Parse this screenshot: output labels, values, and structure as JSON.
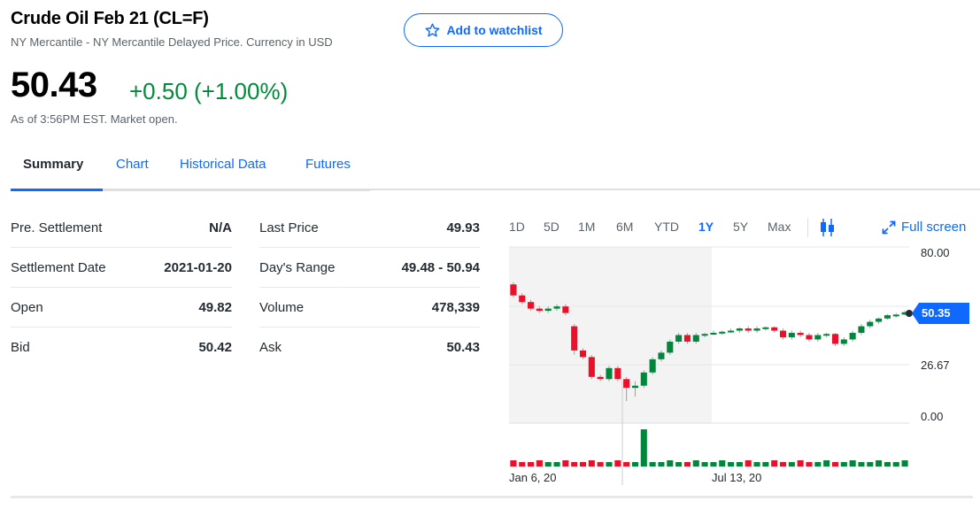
{
  "header": {
    "title": "Crude Oil Feb 21 (CL=F)",
    "subtitle": "NY Mercantile - NY Mercantile Delayed Price. Currency in USD",
    "watchlist_label": "Add to watchlist"
  },
  "quote": {
    "price": "50.43",
    "change": "+0.50 (+1.00%)",
    "as_of": "As of 3:56PM EST. Market open.",
    "change_color": "#008a3b"
  },
  "tabs": [
    {
      "label": "Summary",
      "active": true
    },
    {
      "label": "Chart",
      "active": false
    },
    {
      "label": "Historical Data",
      "active": false
    },
    {
      "label": "Futures",
      "active": false
    }
  ],
  "stats_left": [
    {
      "label": "Pre. Settlement",
      "value": "N/A"
    },
    {
      "label": "Settlement Date",
      "value": "2021-01-20"
    },
    {
      "label": "Open",
      "value": "49.82"
    },
    {
      "label": "Bid",
      "value": "50.42"
    }
  ],
  "stats_right": [
    {
      "label": "Last Price",
      "value": "49.93"
    },
    {
      "label": "Day's Range",
      "value": "49.48 - 50.94"
    },
    {
      "label": "Volume",
      "value": "478,339"
    },
    {
      "label": "Ask",
      "value": "50.43"
    }
  ],
  "chart_controls": {
    "ranges": [
      "1D",
      "5D",
      "1M",
      "6M",
      "YTD",
      "1Y",
      "5Y",
      "Max"
    ],
    "active_range": "1Y",
    "fullscreen_label": "Full screen",
    "chart_type_icon": "candlestick-icon"
  },
  "chart_data": {
    "type": "candlestick",
    "y_ticks": [
      "80.00",
      "26.67",
      "0.00"
    ],
    "x_ticks": [
      "Jan 6, 20",
      "Jul 13, 20"
    ],
    "current_price_tag": "50.35",
    "up_color": "#00873c",
    "down_color": "#eb0f29",
    "candles": [
      {
        "o": 63,
        "c": 58,
        "h": 64,
        "l": 57
      },
      {
        "o": 58,
        "c": 55,
        "h": 59,
        "l": 54
      },
      {
        "o": 55,
        "c": 52,
        "h": 56,
        "l": 51
      },
      {
        "o": 52,
        "c": 51,
        "h": 53,
        "l": 50
      },
      {
        "o": 51,
        "c": 52,
        "h": 53,
        "l": 50
      },
      {
        "o": 52,
        "c": 53,
        "h": 54,
        "l": 51
      },
      {
        "o": 53,
        "c": 50,
        "h": 54,
        "l": 49
      },
      {
        "o": 44,
        "c": 33,
        "h": 45,
        "l": 31
      },
      {
        "o": 33,
        "c": 30,
        "h": 34,
        "l": 29
      },
      {
        "o": 30,
        "c": 21,
        "h": 31,
        "l": 20
      },
      {
        "o": 21,
        "c": 20,
        "h": 22,
        "l": 19
      },
      {
        "o": 20,
        "c": 25,
        "h": 26,
        "l": 19
      },
      {
        "o": 25,
        "c": 20,
        "h": 26,
        "l": 19
      },
      {
        "o": 20,
        "c": 16,
        "h": 21,
        "l": 10
      },
      {
        "o": 16,
        "c": 17,
        "h": 19,
        "l": 12
      },
      {
        "o": 17,
        "c": 23,
        "h": 24,
        "l": 16
      },
      {
        "o": 23,
        "c": 29,
        "h": 30,
        "l": 22
      },
      {
        "o": 29,
        "c": 32,
        "h": 33,
        "l": 28
      },
      {
        "o": 32,
        "c": 37,
        "h": 38,
        "l": 31
      },
      {
        "o": 37,
        "c": 40,
        "h": 41,
        "l": 36
      },
      {
        "o": 40,
        "c": 37,
        "h": 41,
        "l": 36
      },
      {
        "o": 37,
        "c": 40,
        "h": 41,
        "l": 36
      },
      {
        "o": 40,
        "c": 40.5,
        "h": 41,
        "l": 39
      },
      {
        "o": 40.5,
        "c": 41,
        "h": 42,
        "l": 40
      },
      {
        "o": 41,
        "c": 41.5,
        "h": 42,
        "l": 40
      },
      {
        "o": 41.5,
        "c": 42,
        "h": 43,
        "l": 41
      },
      {
        "o": 42,
        "c": 43,
        "h": 43.5,
        "l": 41
      },
      {
        "o": 43,
        "c": 42,
        "h": 44,
        "l": 41
      },
      {
        "o": 42,
        "c": 43,
        "h": 44,
        "l": 41
      },
      {
        "o": 43,
        "c": 43.5,
        "h": 44,
        "l": 42
      },
      {
        "o": 43.5,
        "c": 42,
        "h": 44,
        "l": 41
      },
      {
        "o": 42,
        "c": 39,
        "h": 43,
        "l": 38
      },
      {
        "o": 39,
        "c": 41,
        "h": 42,
        "l": 38
      },
      {
        "o": 41,
        "c": 40,
        "h": 42,
        "l": 39
      },
      {
        "o": 40,
        "c": 38,
        "h": 41,
        "l": 37
      },
      {
        "o": 38,
        "c": 40,
        "h": 41,
        "l": 37
      },
      {
        "o": 40,
        "c": 40.5,
        "h": 41,
        "l": 39
      },
      {
        "o": 40.5,
        "c": 36,
        "h": 41,
        "l": 35
      },
      {
        "o": 36,
        "c": 38,
        "h": 39,
        "l": 35
      },
      {
        "o": 38,
        "c": 41,
        "h": 42,
        "l": 37
      },
      {
        "o": 41,
        "c": 44,
        "h": 45,
        "l": 40
      },
      {
        "o": 44,
        "c": 46,
        "h": 47,
        "l": 43
      },
      {
        "o": 46,
        "c": 47.5,
        "h": 48,
        "l": 45
      },
      {
        "o": 47.5,
        "c": 49,
        "h": 49.5,
        "l": 47
      },
      {
        "o": 49,
        "c": 49.3,
        "h": 50,
        "l": 48
      },
      {
        "o": 49.3,
        "c": 50.35,
        "h": 51,
        "l": 49
      }
    ]
  }
}
